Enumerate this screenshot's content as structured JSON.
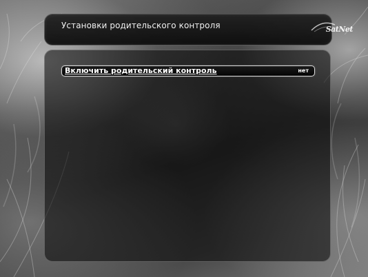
{
  "header": {
    "title": "Установки родительского контроля",
    "brand": "SatNet"
  },
  "menu": {
    "items": [
      {
        "label": "Включить родительский контроль",
        "value": "нет"
      }
    ]
  }
}
